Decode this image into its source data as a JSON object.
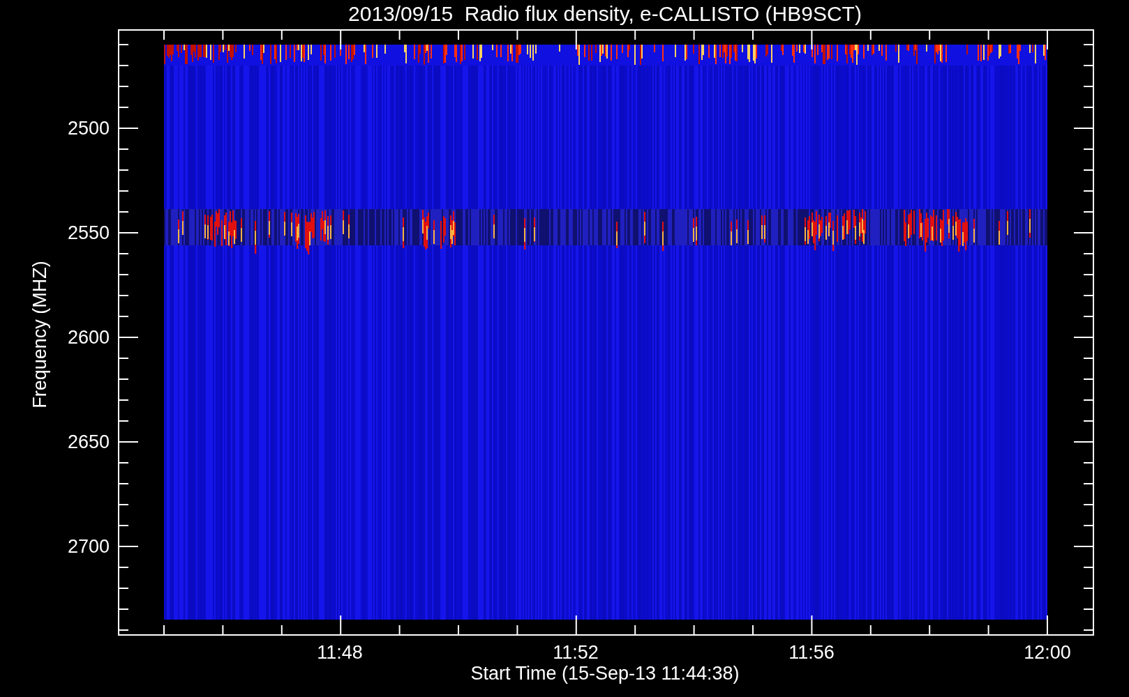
{
  "title": "2013/09/15  Radio flux density, e-CALLISTO (HB9SCT)",
  "y_axis": {
    "label": "Frequency (MHZ)",
    "ticks": [
      "2500",
      "2550",
      "2600",
      "2650",
      "2700"
    ]
  },
  "x_axis": {
    "label": "Start Time (15-Sep-13 11:44:38)",
    "ticks": [
      "11:48",
      "11:52",
      "11:56",
      "12:00"
    ]
  }
}
